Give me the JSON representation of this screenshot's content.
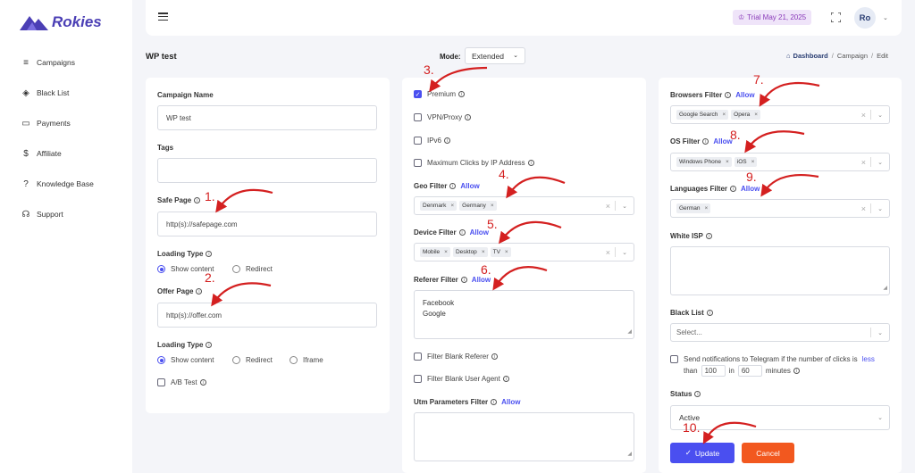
{
  "brand": {
    "name": "Rokies"
  },
  "sidebar": {
    "items": [
      {
        "label": "Campaigns",
        "icon": "campaigns-icon"
      },
      {
        "label": "Black List",
        "icon": "layers-icon"
      },
      {
        "label": "Payments",
        "icon": "credit-card-icon"
      },
      {
        "label": "Affiliate",
        "icon": "dollar-icon"
      },
      {
        "label": "Knowledge Base",
        "icon": "help-circle-icon"
      },
      {
        "label": "Support",
        "icon": "headset-icon"
      }
    ]
  },
  "topbar": {
    "trial": "Trial May 21, 2025",
    "avatar": "Ro"
  },
  "page": {
    "title": "WP test",
    "mode_label": "Mode:",
    "mode_value": "Extended"
  },
  "breadcrumb": {
    "home": "Dashboard",
    "campaign": "Campaign",
    "edit": "Edit"
  },
  "left": {
    "campaign_name_label": "Campaign Name",
    "campaign_name_value": "WP test",
    "tags_label": "Tags",
    "safe_page_label": "Safe Page",
    "safe_page_value": "http(s)://safepage.com",
    "loading_type_label": "Loading Type",
    "show_content": "Show content",
    "redirect": "Redirect",
    "offer_page_label": "Offer Page",
    "offer_page_value": "http(s)://offer.com",
    "loading_type2_label": "Loading Type",
    "show_content2": "Show content",
    "redirect2": "Redirect",
    "iframe": "Iframe",
    "ab_test": "A/B Test"
  },
  "middle": {
    "premium": "Premium",
    "vpn": "VPN/Proxy",
    "ipv6": "IPv6",
    "max_clicks": "Maximum Clicks by IP Address",
    "geo_label": "Geo Filter",
    "geo_tags": [
      "Denmark",
      "Germany"
    ],
    "device_label": "Device Filter",
    "device_tags": [
      "Mobile",
      "Desktop",
      "TV"
    ],
    "referer_label": "Referer Filter",
    "referer_line1": "Facebook",
    "referer_line2": "Google",
    "filter_blank_referer": "Filter Blank Referer",
    "filter_blank_ua": "Filter Blank User Agent",
    "utm_label": "Utm Parameters Filter",
    "allow": "Allow"
  },
  "right": {
    "browsers_label": "Browsers Filter",
    "browser_tags": [
      "Google Search",
      "Opera"
    ],
    "os_label": "OS Filter",
    "os_tags": [
      "Windows Phone",
      "iOS"
    ],
    "languages_label": "Languages Filter",
    "language_tags": [
      "German"
    ],
    "white_isp_label": "White ISP",
    "black_list_label": "Black List",
    "black_list_placeholder": "Select...",
    "telegram_text": "Send notifications to Telegram if the number of clicks is",
    "telegram_less": "less",
    "telegram_than": "than",
    "telegram_in": "in",
    "telegram_minutes": "minutes",
    "clicks_value": "100",
    "minutes_value": "60",
    "status_label": "Status",
    "status_value": "Active",
    "update": "Update",
    "cancel": "Cancel",
    "allow": "Allow"
  },
  "annotations": [
    "1.",
    "2.",
    "3.",
    "4.",
    "5.",
    "6.",
    "7.",
    "8.",
    "9.",
    "10."
  ],
  "colors": {
    "accent": "#4a4ff0",
    "brand": "#4b3fb5",
    "cancel": "#f2581f",
    "annotation": "#d42020"
  }
}
